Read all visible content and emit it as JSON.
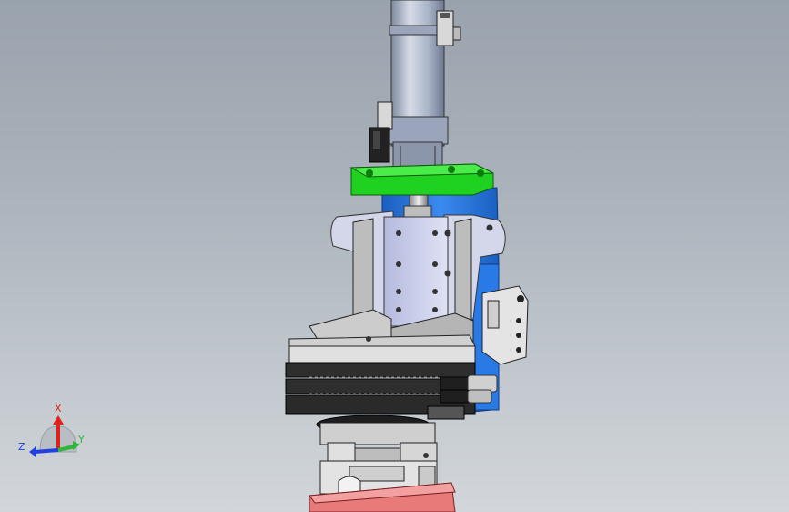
{
  "viewport": {
    "kind": "3D CAD assembly viewport",
    "background_top": "#9aa3ad",
    "background_bottom": "#d2d6da"
  },
  "triad": {
    "x_label": "X",
    "y_label": "Y",
    "z_label": "Z",
    "x_color": "#e0201c",
    "y_color": "#2db83a",
    "z_color": "#2040e0"
  },
  "parts": {
    "cylinder_color": "#aab4c8",
    "mount_plate_color": "#1fd21f",
    "side_rail_color": "#2f7fe0",
    "bracket_color": "#c8cce8",
    "frame_color": "#b8b8b8",
    "gripper_color": "#303030",
    "base_plate_color": "#e87a7a"
  }
}
